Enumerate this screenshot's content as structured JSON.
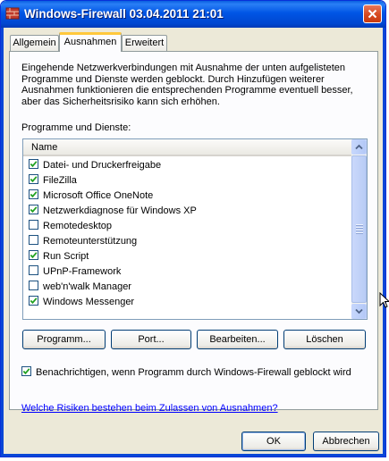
{
  "window": {
    "title": "Windows-Firewall 03.04.2011 21:01"
  },
  "tabs": [
    {
      "label": "Allgemein",
      "active": false
    },
    {
      "label": "Ausnahmen",
      "active": true
    },
    {
      "label": "Erweitert",
      "active": false
    }
  ],
  "description": "Eingehende Netzwerkverbindungen mit Ausnahme der unten aufgelisteten Programme und Dienste werden geblockt. Durch Hinzufügen weiterer Ausnahmen funktionieren die entsprechenden Programme eventuell besser, aber das Sicherheitsrisiko kann sich erhöhen.",
  "list_label": "Programme und Dienste:",
  "list": {
    "column_header": "Name",
    "items": [
      {
        "label": "Datei- und Druckerfreigabe",
        "checked": true
      },
      {
        "label": "FileZilla",
        "checked": true
      },
      {
        "label": "Microsoft Office OneNote",
        "checked": true
      },
      {
        "label": "Netzwerkdiagnose für Windows XP",
        "checked": true
      },
      {
        "label": "Remotedesktop",
        "checked": false
      },
      {
        "label": "Remoteunterstützung",
        "checked": false
      },
      {
        "label": "Run Script",
        "checked": true
      },
      {
        "label": "UPnP-Framework",
        "checked": false
      },
      {
        "label": "web'n'walk Manager",
        "checked": false
      },
      {
        "label": "Windows Messenger",
        "checked": true
      }
    ]
  },
  "buttons": {
    "programm": "Programm...",
    "port": "Port...",
    "bearbeiten": "Bearbeiten...",
    "loeschen": "Löschen",
    "ok": "OK",
    "abbrechen": "Abbrechen"
  },
  "notify": {
    "label": "Benachrichtigen, wenn Programm durch Windows-Firewall geblockt wird",
    "checked": true
  },
  "help_link": "Welche Risiken bestehen beim Zulassen von Ausnahmen?",
  "colors": {
    "titlebar": "#0055e5",
    "dialog_bg": "#ece9d8",
    "link": "#0000ff",
    "active_tab_accent": "#ffc83c"
  }
}
